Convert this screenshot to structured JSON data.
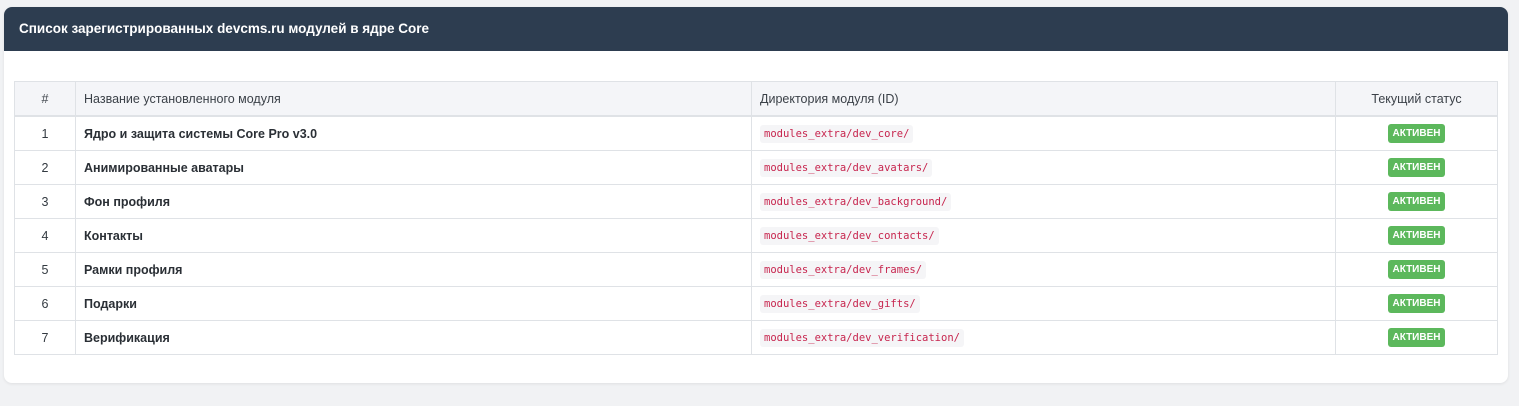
{
  "header": {
    "title": "Список зарегистрированных devcms.ru модулей в ядре Core"
  },
  "table": {
    "columns": [
      "#",
      "Название установленного модуля",
      "Директория модуля (ID)",
      "Текущий статус"
    ],
    "rows": [
      {
        "num": "1",
        "name": "Ядро и защита системы Core Pro v3.0",
        "dir": "modules_extra/dev_core/",
        "status": "АКТИВЕН"
      },
      {
        "num": "2",
        "name": "Анимированные аватары",
        "dir": "modules_extra/dev_avatars/",
        "status": "АКТИВЕН"
      },
      {
        "num": "3",
        "name": "Фон профиля",
        "dir": "modules_extra/dev_background/",
        "status": "АКТИВЕН"
      },
      {
        "num": "4",
        "name": "Контакты",
        "dir": "modules_extra/dev_contacts/",
        "status": "АКТИВЕН"
      },
      {
        "num": "5",
        "name": "Рамки профиля",
        "dir": "modules_extra/dev_frames/",
        "status": "АКТИВЕН"
      },
      {
        "num": "6",
        "name": "Подарки",
        "dir": "modules_extra/dev_gifts/",
        "status": "АКТИВЕН"
      },
      {
        "num": "7",
        "name": "Верификация",
        "dir": "modules_extra/dev_verification/",
        "status": "АКТИВЕН"
      }
    ]
  },
  "colors": {
    "header_bg": "#2d3d50",
    "status_active": "#5cb85c",
    "code_text": "#c7254e"
  }
}
